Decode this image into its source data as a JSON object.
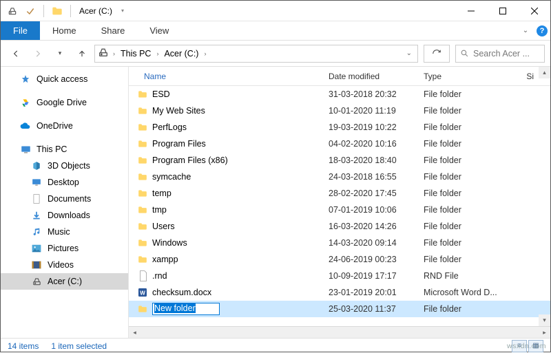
{
  "window": {
    "title": "Acer (C:)"
  },
  "ribbon": {
    "file": "File",
    "home": "Home",
    "share": "Share",
    "view": "View"
  },
  "breadcrumb": {
    "root": "This PC",
    "drive": "Acer (C:)"
  },
  "search": {
    "placeholder": "Search Acer ..."
  },
  "sidebar": {
    "quick": "Quick access",
    "gdrive": "Google Drive",
    "onedrive": "OneDrive",
    "thispc": "This PC",
    "obj3d": "3D Objects",
    "desktop": "Desktop",
    "documents": "Documents",
    "downloads": "Downloads",
    "music": "Music",
    "pictures": "Pictures",
    "videos": "Videos",
    "acer": "Acer (C:)"
  },
  "columns": {
    "name": "Name",
    "date": "Date modified",
    "type": "Type",
    "size": "Si"
  },
  "rows": [
    {
      "name": "ESD",
      "date": "31-03-2018 20:32",
      "type": "File folder",
      "icon": "folder"
    },
    {
      "name": "My Web Sites",
      "date": "10-01-2020 11:19",
      "type": "File folder",
      "icon": "folder"
    },
    {
      "name": "PerfLogs",
      "date": "19-03-2019 10:22",
      "type": "File folder",
      "icon": "folder"
    },
    {
      "name": "Program Files",
      "date": "04-02-2020 10:16",
      "type": "File folder",
      "icon": "folder"
    },
    {
      "name": "Program Files (x86)",
      "date": "18-03-2020 18:40",
      "type": "File folder",
      "icon": "folder"
    },
    {
      "name": "symcache",
      "date": "24-03-2018 16:55",
      "type": "File folder",
      "icon": "folder"
    },
    {
      "name": "temp",
      "date": "28-02-2020 17:45",
      "type": "File folder",
      "icon": "folder"
    },
    {
      "name": "tmp",
      "date": "07-01-2019 10:06",
      "type": "File folder",
      "icon": "folder"
    },
    {
      "name": "Users",
      "date": "16-03-2020 14:26",
      "type": "File folder",
      "icon": "folder"
    },
    {
      "name": "Windows",
      "date": "14-03-2020 09:14",
      "type": "File folder",
      "icon": "folder"
    },
    {
      "name": "xampp",
      "date": "24-06-2019 00:23",
      "type": "File folder",
      "icon": "folder"
    },
    {
      "name": ".rnd",
      "date": "10-09-2019 17:17",
      "type": "RND File",
      "icon": "file"
    },
    {
      "name": "checksum.docx",
      "date": "23-01-2019 20:01",
      "type": "Microsoft Word D...",
      "icon": "word"
    }
  ],
  "new_item": {
    "name": "New folder",
    "date": "25-03-2020 11:37",
    "type": "File folder"
  },
  "status": {
    "count": "14 items",
    "selection": "1 item selected"
  },
  "watermark": "wsxdn.com"
}
